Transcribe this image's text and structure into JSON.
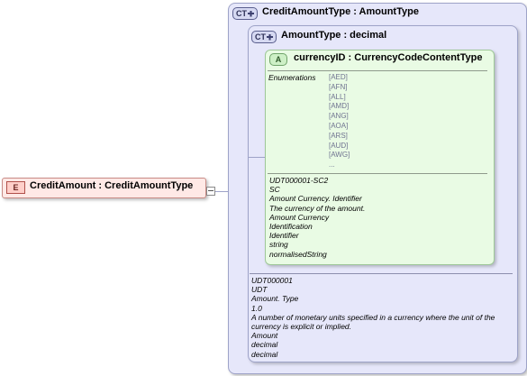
{
  "element": {
    "badge": "E",
    "title": "CreditAmount : CreditAmountType"
  },
  "outer_type": {
    "badge": "CT",
    "title": "CreditAmountType : AmountType"
  },
  "inner_type": {
    "badge": "CT",
    "title": "AmountType : decimal",
    "annotations": [
      "UDT000001",
      "UDT",
      "Amount. Type",
      "1.0",
      "A number of monetary units specified in a currency where the unit of the currency is explicit or implied.",
      "Amount",
      "decimal",
      "decimal"
    ]
  },
  "attribute": {
    "badge": "A",
    "title": "currencyID : CurrencyCodeContentType",
    "enumerations_label": "Enumerations",
    "enumerations": [
      "[AED]",
      "[AFN]",
      "[ALL]",
      "[AMD]",
      "[ANG]",
      "[AOA]",
      "[ARS]",
      "[AUD]",
      "[AWG]",
      "..."
    ],
    "annotations": [
      "UDT000001-SC2",
      "SC",
      "Amount Currency. Identifier",
      "The currency of the amount.",
      "Amount Currency",
      "Identification",
      "Identifier",
      "string",
      "normalisedString"
    ]
  },
  "colors": {
    "type_box_fill": "#e6e7fa",
    "type_box_border": "#9ea3c8",
    "attribute_fill": "#e9fbe4",
    "attribute_border": "#8fbf86",
    "element_fill": "#ffe9e6",
    "element_border": "#c88a85"
  }
}
